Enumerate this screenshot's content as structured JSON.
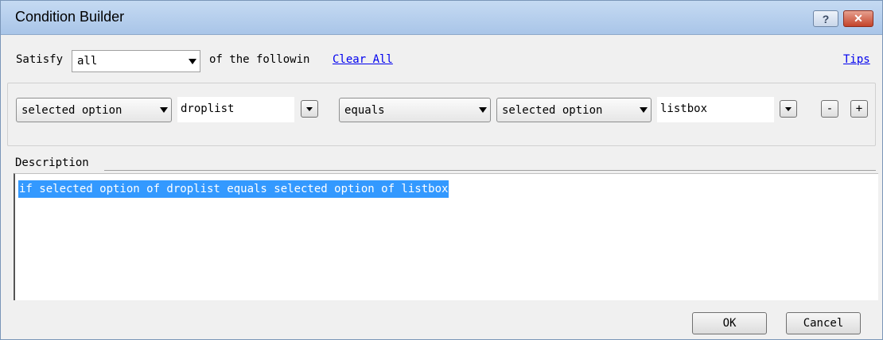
{
  "window": {
    "title": "Condition Builder",
    "help_glyph": "?",
    "close_glyph": "✕"
  },
  "top_row": {
    "satisfy_label": "Satisfy",
    "satisfy_value": "all",
    "following_text": "of the followin",
    "clear_all_link": "Clear All",
    "tips_link": "Tips"
  },
  "condition": {
    "left_type": "selected option",
    "left_field": "droplist",
    "operator": "equals",
    "right_type": "selected option",
    "right_field": "listbox",
    "remove_label": "-",
    "add_label": "+"
  },
  "description": {
    "label": "Description",
    "text": "if selected option of droplist equals selected option of listbox"
  },
  "footer": {
    "ok_label": "OK",
    "cancel_label": "Cancel"
  },
  "colors": {
    "selection": "#3399ff",
    "titlebar": "#b8d0ee",
    "link": "#0000ee",
    "background": "#f0f0f0"
  }
}
